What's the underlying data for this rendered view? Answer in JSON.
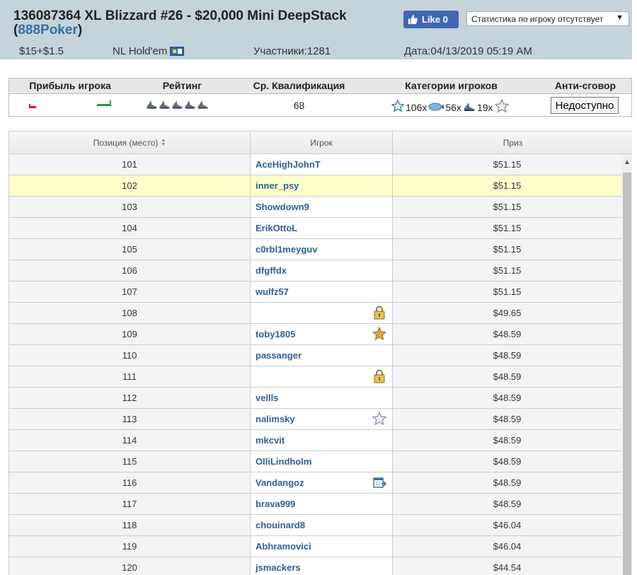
{
  "header": {
    "title_main": "136087364 XL Blizzard #26 - $20,000 Mini DeepStack",
    "room_open": "(",
    "room": "888Poker",
    "room_close": ")",
    "like_label": "Like 0",
    "stats_select_value": "Статистика по игроку отсутствует",
    "buyin": "$15+$1.5",
    "game": "NL Hold'em",
    "players": "Участники:1281",
    "date": "Дата:04/13/2019 05:19 AM",
    "colors": {
      "background": "#c5d3da",
      "link": "#2f6fa8",
      "like": "#4267b2"
    }
  },
  "stats": {
    "headers": {
      "profit": "Прибыль игрока",
      "rating": "Рейтинг",
      "qualification": "Ср. Квалификация",
      "categories": "Категории игроков",
      "anti_collusion": "Анти-сговор"
    },
    "rating_sharks": 5,
    "qualification": "68",
    "categories": [
      {
        "icon": "star-outline-icon",
        "count": "106x"
      },
      {
        "icon": "fish-icon",
        "count": "56x"
      },
      {
        "icon": "shark-icon",
        "count": "19x"
      }
    ],
    "anti_collusion_button": "Недоступно"
  },
  "results": {
    "columns": {
      "position": "Позиция (место)",
      "player": "Игрок",
      "prize": "Приз"
    },
    "rows": [
      {
        "pos": "101",
        "player": "AceHighJohnT",
        "prize": "$51.15",
        "badge": ""
      },
      {
        "pos": "102",
        "player": "inner_psy",
        "prize": "$51.15",
        "badge": "",
        "highlight": true
      },
      {
        "pos": "103",
        "player": "Showdown9",
        "prize": "$51.15",
        "badge": ""
      },
      {
        "pos": "104",
        "player": "ErikOttoL",
        "prize": "$51.15",
        "badge": ""
      },
      {
        "pos": "105",
        "player": "c0rbl1meyguv",
        "prize": "$51.15",
        "badge": ""
      },
      {
        "pos": "106",
        "player": "dfgffdx",
        "prize": "$51.15",
        "badge": ""
      },
      {
        "pos": "107",
        "player": "wulfz57",
        "prize": "$51.15",
        "badge": ""
      },
      {
        "pos": "108",
        "player": "",
        "prize": "$49.65",
        "badge": "lock"
      },
      {
        "pos": "109",
        "player": "toby1805",
        "prize": "$48.59",
        "badge": "star-gold"
      },
      {
        "pos": "110",
        "player": "passanger",
        "prize": "$48.59",
        "badge": ""
      },
      {
        "pos": "111",
        "player": "",
        "prize": "$48.59",
        "badge": "lock"
      },
      {
        "pos": "112",
        "player": "vellls",
        "prize": "$48.59",
        "badge": ""
      },
      {
        "pos": "113",
        "player": "nalimsky",
        "prize": "$48.59",
        "badge": "star-outline"
      },
      {
        "pos": "114",
        "player": "mkcvit",
        "prize": "$48.59",
        "badge": ""
      },
      {
        "pos": "115",
        "player": "OlliLindholm",
        "prize": "$48.59",
        "badge": ""
      },
      {
        "pos": "116",
        "player": "Vandangoz",
        "prize": "$48.59",
        "badge": "calendar"
      },
      {
        "pos": "117",
        "player": "brava999",
        "prize": "$48.59",
        "badge": ""
      },
      {
        "pos": "118",
        "player": "chouinard8",
        "prize": "$46.04",
        "badge": ""
      },
      {
        "pos": "119",
        "player": "Abhramovici",
        "prize": "$46.04",
        "badge": ""
      },
      {
        "pos": "120",
        "player": "jsmackers",
        "prize": "$44.54",
        "badge": ""
      }
    ],
    "highlight_color": "#ffffcc"
  }
}
